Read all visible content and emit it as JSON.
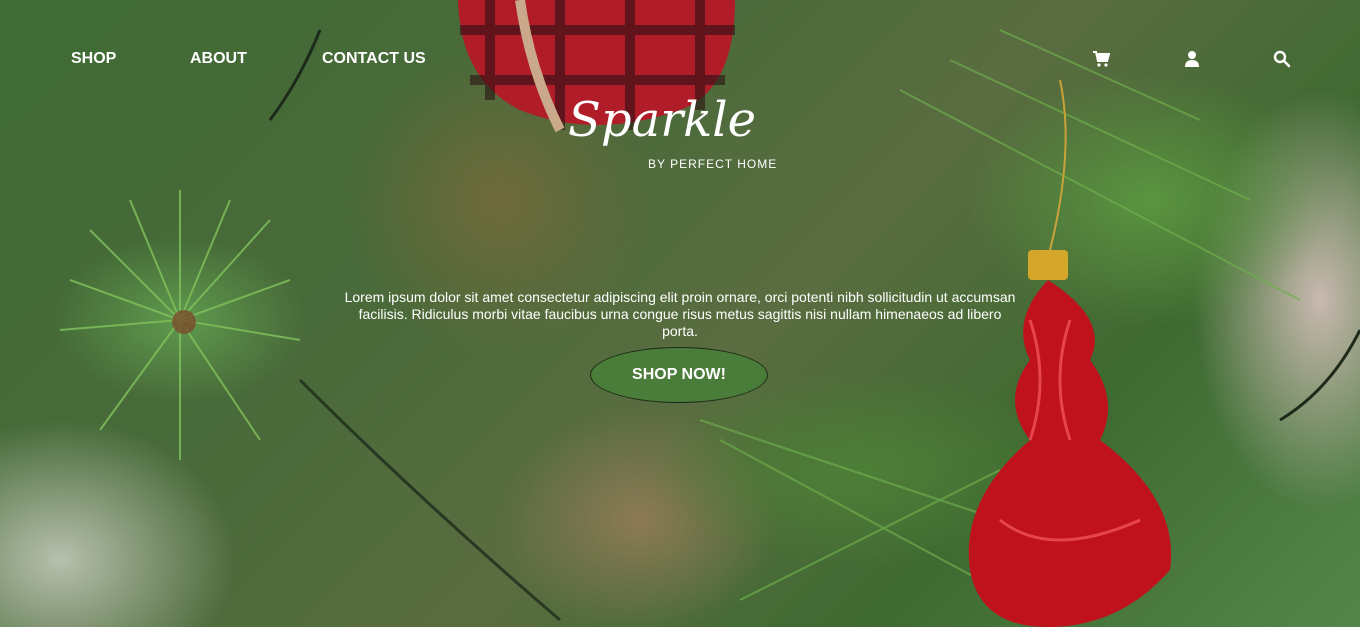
{
  "nav": {
    "shop": "SHOP",
    "about": "ABOUT",
    "contact": "CONTACT US"
  },
  "icons": [
    "cart-icon",
    "user-icon",
    "search-icon"
  ],
  "logo": {
    "name": "Sparkle",
    "subtitle": "BY PERFECT HOME"
  },
  "hero": {
    "text": "Lorem ipsum dolor sit amet consectetur adipiscing elit proin ornare, orci potenti nibh sollicitudin ut accumsan facilisis. Ridiculus morbi vitae faucibus urna congue risus metus sagittis nisi nullam himenaeos ad libero porta.",
    "cta": "SHOP NOW!"
  },
  "colors": {
    "cta_background": "#4a7c3a",
    "text": "#ffffff",
    "ornament_red": "#c0121c"
  }
}
